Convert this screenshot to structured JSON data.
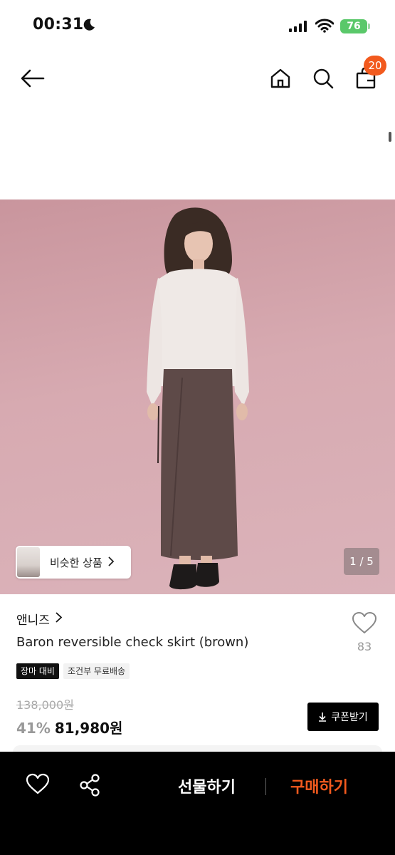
{
  "status_bar": {
    "time": "00:31",
    "battery": "76"
  },
  "nav": {
    "cart_count": "20"
  },
  "hero": {
    "similar_label": "비슷한 상품",
    "page_indicator": "1 / 5"
  },
  "product": {
    "brand": "앤니즈",
    "title": "Baron reversible check skirt (brown)",
    "like_count": "83",
    "tags": [
      "장마 대비",
      "조건부 무료배송"
    ],
    "original_price": "138,000원",
    "discount": "41%",
    "sale_price": "81,980원",
    "coupon_label": "쿠폰받기"
  },
  "bottom_bar": {
    "gift_label": "선물하기",
    "buy_label": "구매하기"
  },
  "colors": {
    "accent": "#f25a1e",
    "battery": "#5ac86a",
    "background_hero": "#d4a7ae"
  }
}
